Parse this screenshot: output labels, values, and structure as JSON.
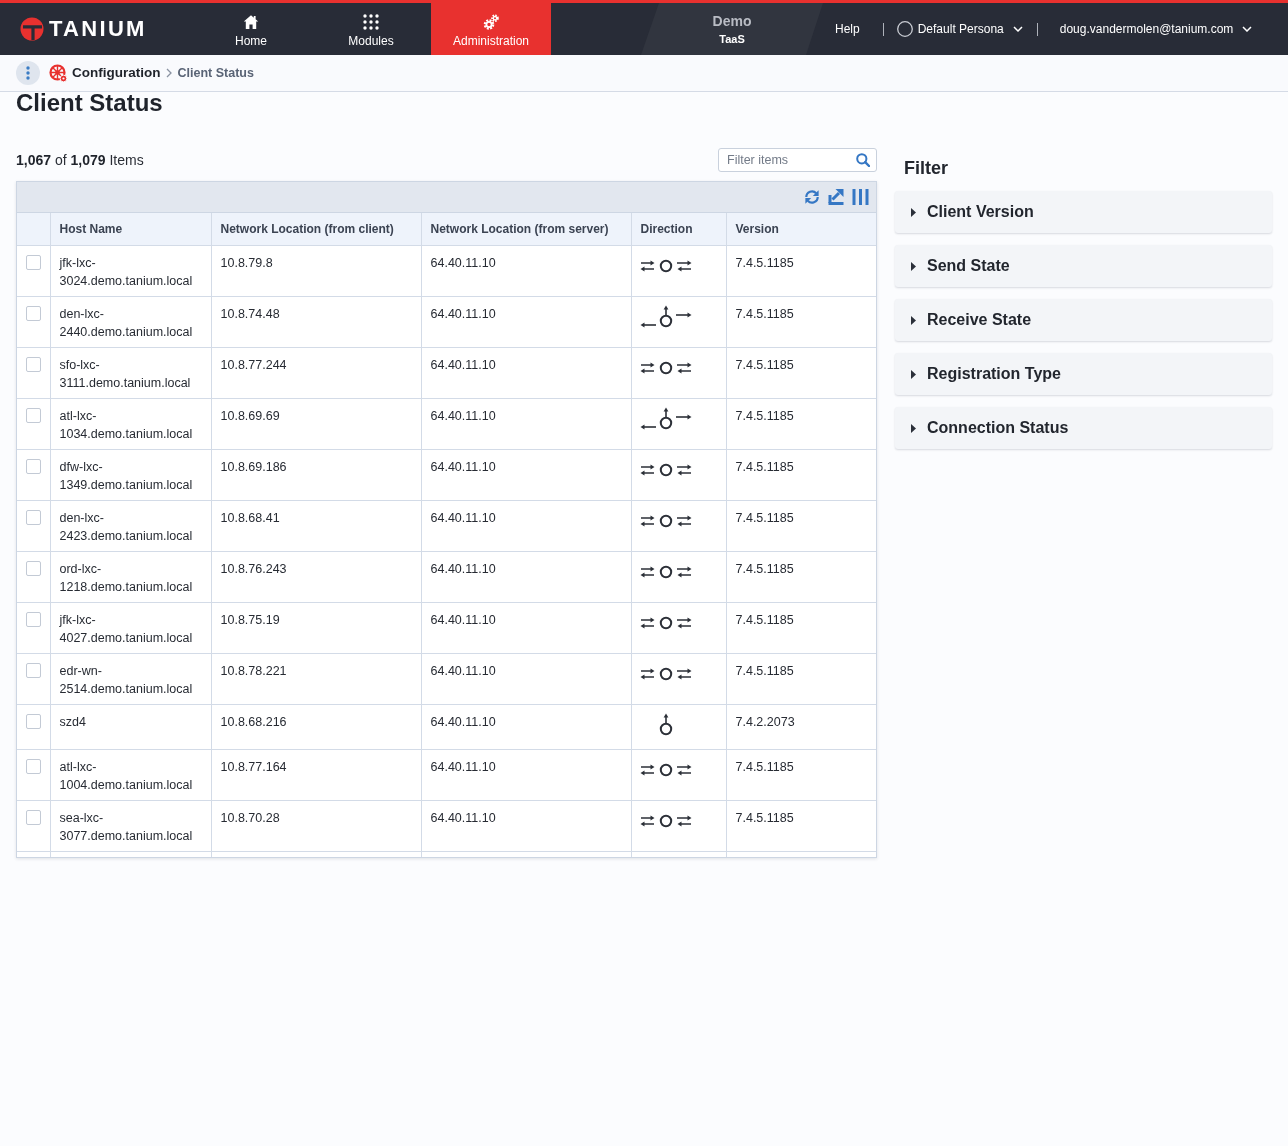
{
  "header": {
    "brand": "TANIUM",
    "nav": [
      {
        "label": "Home",
        "selected": false
      },
      {
        "label": "Modules",
        "selected": false
      },
      {
        "label": "Administration",
        "selected": true
      }
    ],
    "instance": {
      "name": "Demo",
      "tier": "TaaS"
    },
    "help": "Help",
    "persona": "Default Persona",
    "user": "doug.vandermolen@tanium.com"
  },
  "breadcrumb": {
    "parent": "Configuration",
    "current": "Client Status"
  },
  "page_title": "Client Status",
  "summary": "**1,067** of **1,079** Items",
  "search": {
    "placeholder": "Filter items"
  },
  "table": {
    "columns": [
      "Host Name",
      "Network Location (from client)",
      "Network Location (from server)",
      "Direction",
      "Version"
    ],
    "rows": [
      {
        "checked": false,
        "host_name": "jfk-lxc-3024.demo.tanium.local",
        "client_location": "10.8.79.8",
        "server_location": "64.40.11.10",
        "direction": {
          "kind": "both"
        },
        "version": "7.4.5.1185"
      },
      {
        "checked": false,
        "host_name": "den-lxc-2440.demo.tanium.local",
        "client_location": "10.8.74.48",
        "server_location": "64.40.11.10",
        "direction": {
          "kind": "split"
        },
        "version": "7.4.5.1185"
      },
      {
        "checked": false,
        "host_name": "sfo-lxc-3111.demo.tanium.local",
        "client_location": "10.8.77.244",
        "server_location": "64.40.11.10",
        "direction": {
          "kind": "both"
        },
        "version": "7.4.5.1185"
      },
      {
        "checked": false,
        "host_name": "atl-lxc-1034.demo.tanium.local",
        "client_location": "10.8.69.69",
        "server_location": "64.40.11.10",
        "direction": {
          "kind": "split"
        },
        "version": "7.4.5.1185"
      },
      {
        "checked": false,
        "host_name": "dfw-lxc-1349.demo.tanium.local",
        "client_location": "10.8.69.186",
        "server_location": "64.40.11.10",
        "direction": {
          "kind": "both"
        },
        "version": "7.4.5.1185"
      },
      {
        "checked": false,
        "host_name": "den-lxc-2423.demo.tanium.local",
        "client_location": "10.8.68.41",
        "server_location": "64.40.11.10",
        "direction": {
          "kind": "both"
        },
        "version": "7.4.5.1185"
      },
      {
        "checked": false,
        "host_name": "ord-lxc-1218.demo.tanium.local",
        "client_location": "10.8.76.243",
        "server_location": "64.40.11.10",
        "direction": {
          "kind": "both"
        },
        "version": "7.4.5.1185"
      },
      {
        "checked": false,
        "host_name": "jfk-lxc-4027.demo.tanium.local",
        "client_location": "10.8.75.19",
        "server_location": "64.40.11.10",
        "direction": {
          "kind": "both"
        },
        "version": "7.4.5.1185"
      },
      {
        "checked": false,
        "host_name": "edr-wn-2514.demo.tanium.local",
        "client_location": "10.8.78.221",
        "server_location": "64.40.11.10",
        "direction": {
          "kind": "both"
        },
        "version": "7.4.5.1185"
      },
      {
        "checked": false,
        "host_name": "szd4",
        "client_location": "10.8.68.216",
        "server_location": "64.40.11.10",
        "direction": {
          "kind": "up"
        },
        "version": "7.4.2.2073"
      },
      {
        "checked": false,
        "host_name": "atl-lxc-1004.demo.tanium.local",
        "client_location": "10.8.77.164",
        "server_location": "64.40.11.10",
        "direction": {
          "kind": "both"
        },
        "version": "7.4.5.1185"
      },
      {
        "checked": false,
        "host_name": "sea-lxc-3077.demo.tanium.local",
        "client_location": "10.8.70.28",
        "server_location": "64.40.11.10",
        "direction": {
          "kind": "both"
        },
        "version": "7.4.5.1185"
      }
    ]
  },
  "filter": {
    "title": "Filter",
    "sections": [
      {
        "label": "Client Version",
        "expanded": false
      },
      {
        "label": "Send State",
        "expanded": false
      },
      {
        "label": "Receive State",
        "expanded": false
      },
      {
        "label": "Registration Type",
        "expanded": false
      },
      {
        "label": "Connection Status",
        "expanded": false
      }
    ]
  }
}
